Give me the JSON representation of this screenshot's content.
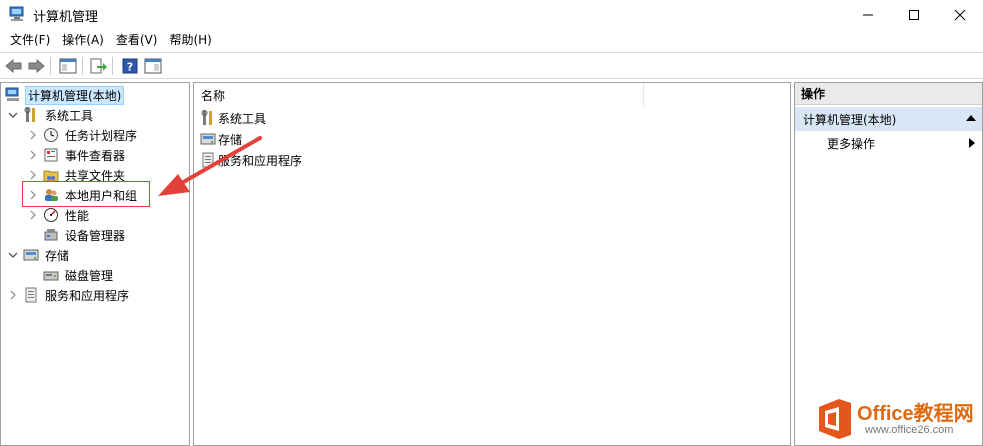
{
  "window": {
    "title": "计算机管理",
    "app_icon": "computer-management-icon"
  },
  "menu": [
    "文件(F)",
    "操作(A)",
    "查看(V)",
    "帮助(H)"
  ],
  "tree": {
    "root": "计算机管理(本地)",
    "system_tools": "系统工具",
    "task_scheduler": "任务计划程序",
    "event_viewer": "事件查看器",
    "shared_folders": "共享文件夹",
    "local_users": "本地用户和组",
    "performance": "性能",
    "device_manager": "设备管理器",
    "storage": "存储",
    "disk_management": "磁盘管理",
    "services_apps": "服务和应用程序"
  },
  "list": {
    "column_name": "名称",
    "items": [
      "系统工具",
      "存储",
      "服务和应用程序"
    ]
  },
  "actions": {
    "header": "操作",
    "section": "计算机管理(本地)",
    "more": "更多操作"
  },
  "watermark": {
    "brand": "Office教程网",
    "url": "www.office26.com"
  },
  "colors": {
    "selection": "#cce8ff",
    "highlight_border": "#e3403a",
    "action_section": "#d9e6f5",
    "watermark_orange": "#e06a10"
  }
}
